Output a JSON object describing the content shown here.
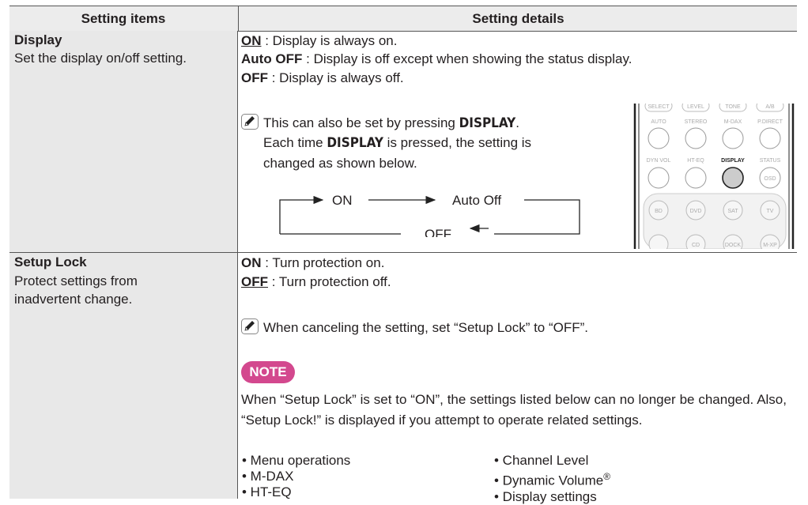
{
  "header": {
    "col1": "Setting items",
    "col2": "Setting details"
  },
  "display": {
    "title": "Display",
    "description": "Set the display on/off setting.",
    "opt_on_key": "ON",
    "opt_on_text": " : Display is always on.",
    "opt_auto_key": "Auto OFF",
    "opt_auto_text": " : Display is off except when showing the status display.",
    "opt_off_key": "OFF",
    "opt_off_text": " : Display is always off.",
    "tip_line1_a": "This can also be set by pressing ",
    "tip_line1_b": "DISPLAY",
    "tip_line1_c": ".",
    "tip_line2_a": "Each time ",
    "tip_line2_b": "DISPLAY",
    "tip_line2_c": " is pressed, the setting is",
    "tip_line3": "changed as shown below.",
    "cycle": {
      "on": "ON",
      "auto": "Auto Off",
      "off": "OFF"
    },
    "remote": {
      "row1": [
        "SELECT",
        "LEVEL",
        "TONE",
        "A/B"
      ],
      "row2": [
        "AUTO",
        "STEREO",
        "M-DAX",
        "P.DIRECT"
      ],
      "row3": [
        "DYN VOL",
        "HT-EQ",
        "DISPLAY",
        "STATUS"
      ],
      "row3_btn": "OSD",
      "row4": [
        "BD",
        "DVD",
        "SAT",
        "TV"
      ],
      "row5": [
        "CD",
        "DOCK",
        "M-XP"
      ]
    }
  },
  "setup_lock": {
    "title": "Setup Lock",
    "description": "Protect settings from inadvertent change.",
    "opt_on_key": "ON",
    "opt_on_text": " : Turn protection on.",
    "opt_off_key": "OFF",
    "opt_off_text": " : Turn protection off.",
    "tip": "When canceling the setting, set “Setup Lock” to “OFF”.",
    "note_label": "NOTE",
    "note_text": "When “Setup Lock” is set to “ON”, the settings listed below can no longer be changed. Also, “Setup Lock!” is displayed if you attempt to operate related settings.",
    "list_left": [
      "• Menu operations",
      "• M-DAX",
      "• HT-EQ"
    ],
    "list_right": [
      "• Channel Level",
      "• Dynamic Volume",
      "• Display settings"
    ],
    "reg_mark": "®"
  }
}
